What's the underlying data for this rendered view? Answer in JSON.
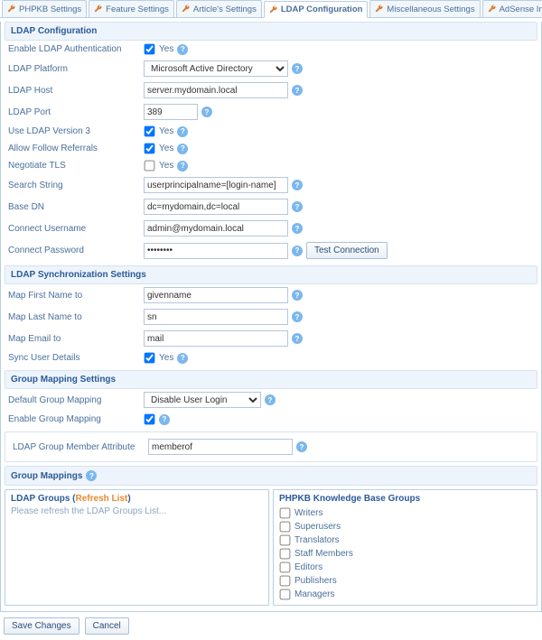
{
  "tabs": [
    {
      "label": "PHPKB Settings"
    },
    {
      "label": "Feature Settings"
    },
    {
      "label": "Article's Settings"
    },
    {
      "label": "LDAP Configuration",
      "active": true
    },
    {
      "label": "Miscellaneous Settings"
    },
    {
      "label": "AdSense Integration"
    }
  ],
  "sections": {
    "config": "LDAP Configuration",
    "sync": "LDAP Synchronization Settings",
    "groupmap": "Group Mapping Settings",
    "mappings": "Group Mappings"
  },
  "labels": {
    "enable_auth": "Enable LDAP Authentication",
    "platform": "LDAP Platform",
    "host": "LDAP Host",
    "port": "LDAP Port",
    "v3": "Use LDAP Version 3",
    "follow": "Allow Follow Referrals",
    "tls": "Negotiate TLS",
    "search": "Search String",
    "basedn": "Base DN",
    "conn_user": "Connect Username",
    "conn_pass": "Connect Password",
    "map_first": "Map First Name to",
    "map_last": "Map Last Name to",
    "map_email": "Map Email to",
    "sync_details": "Sync User Details",
    "default_group": "Default Group Mapping",
    "enable_group": "Enable Group Mapping",
    "member_attr": "LDAP Group Member Attribute",
    "yes": "Yes",
    "test": "Test Connection",
    "save": "Save Changes",
    "cancel": "Cancel",
    "ldap_groups_hdr": "LDAP Groups",
    "refresh": "Refresh List",
    "ldap_groups_placeholder": "Please refresh the LDAP Groups List...",
    "kb_groups_hdr": "PHPKB Knowledge Base Groups"
  },
  "values": {
    "platform": "Microsoft Active Directory",
    "host": "server.mydomain.local",
    "port": "389",
    "search": "userprincipalname=[login-name]",
    "basedn": "dc=mydomain,dc=local",
    "conn_user": "admin@mydomain.local",
    "conn_pass": "••••••••",
    "map_first": "givenname",
    "map_last": "sn",
    "map_email": "mail",
    "default_group": "Disable User Login",
    "member_attr": "memberof"
  },
  "checks": {
    "enable_auth": true,
    "v3": true,
    "follow": true,
    "tls": false,
    "sync_details": true,
    "enable_group": true
  },
  "kb_groups": [
    {
      "label": "Writers"
    },
    {
      "label": "Superusers"
    },
    {
      "label": "Translators"
    },
    {
      "label": "Staff Members"
    },
    {
      "label": "Editors"
    },
    {
      "label": "Publishers"
    },
    {
      "label": "Managers"
    }
  ]
}
